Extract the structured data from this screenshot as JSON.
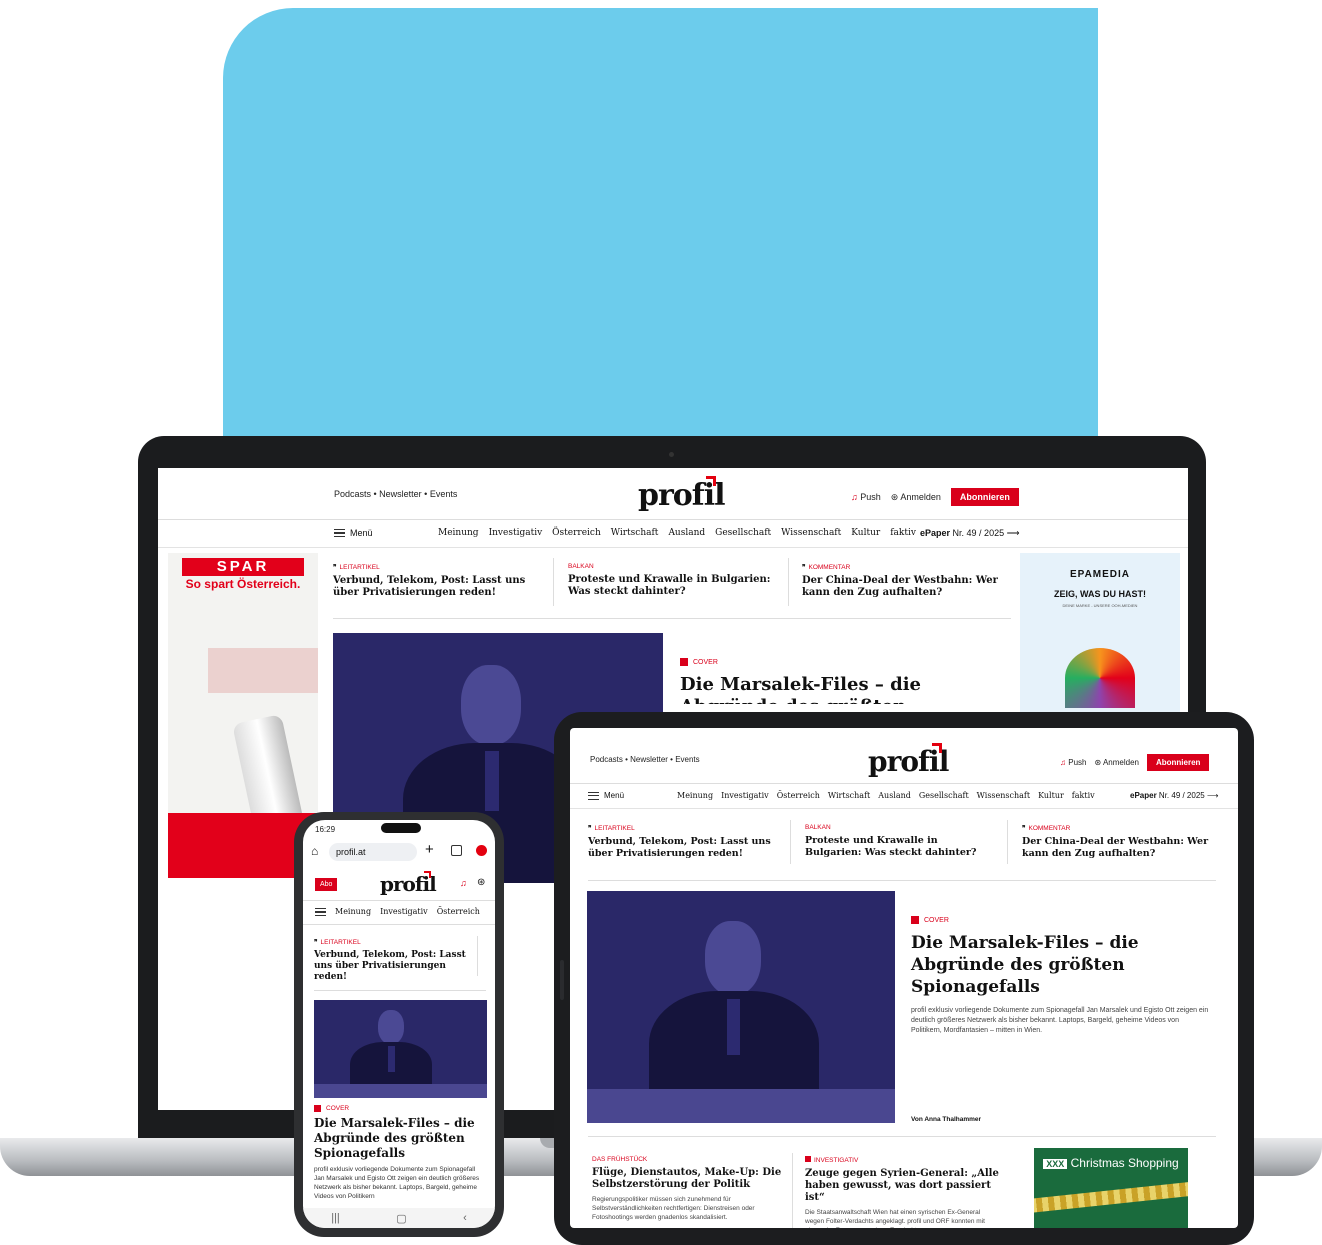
{
  "site": {
    "logo": "profil",
    "top_links": "Podcasts  •  Newsletter  •  Events",
    "push": "Push",
    "login": "Anmelden",
    "subscribe": "Abonnieren",
    "menu": "Menü",
    "nav": [
      "Meinung",
      "Investigativ",
      "Österreich",
      "Wirtschaft",
      "Ausland",
      "Gesellschaft",
      "Wissenschaft",
      "Kultur",
      "faktiv"
    ],
    "epaper_label": "ePaper",
    "epaper_issue": "Nr. 49 / 2025",
    "arrow": "⟶"
  },
  "headlines": [
    {
      "kicker": "Leitartikel",
      "title": "Verbund, Telekom, Post: Lasst uns über Privatisierungen reden!",
      "quote": true
    },
    {
      "kicker": "Balkan",
      "title": "Proteste und Krawalle in Bulgarien: Was steckt dahinter?",
      "quote": false
    },
    {
      "kicker": "Kommentar",
      "title": "Der China-Deal der Westbahn: Wer kann den Zug aufhalten?",
      "quote": true
    }
  ],
  "cover": {
    "kicker": "COVER",
    "title": "Die Marsalek-Files – die Abgründe des größten Spionagefalls",
    "teaser": "profil exklusiv vorliegende Dokumente zum Spionagefall Jan Marsalek und Egisto Ott zeigen ein deutlich größeres Netzwerk als bisher bekannt. Laptops, Bargeld, geheime Videos von Politikern, Mordfantasien – mitten in Wien.",
    "author": "Von Anna Thalhammer"
  },
  "laptop_cover_title_partial": "Die Marsalek-Files – die Abgründe des größten Spionagefalls",
  "secondary": [
    {
      "kicker": "DAS FRÜHSTÜCK",
      "title": "Flüge, Dienstautos, Make-Up: Die Selbstzerstörung der Politik",
      "teaser": "Regierungspolitiker müssen sich zunehmend für Selbstverständlichkeiten rechtfertigen: Dienstreisen oder Fotoshootings werden gnadenlos skandalisiert."
    },
    {
      "kicker": "INVESTIGATIV",
      "title": "Zeuge gegen Syrien-General: „Alle haben gewusst, was dort passiert ist“",
      "teaser": "Die Staatsanwaltschaft Wien hat einen syrischen Ex-General wegen Folter-Verdachts angeklagt. profil und ORF konnten mit einem der Zeugen sprechen. Er erhebt"
    }
  ],
  "ads": {
    "spar_logo": "SPAR",
    "spar_tagline": "So spart Österreich.",
    "epamedia_name": "EPAMEDIA",
    "epamedia_tagline": "ZEIG, WAS DU HAST!",
    "epamedia_sub": "DEINE MARKE - UNSERE OOH-MEDIEN",
    "xxx_brand": "XXX",
    "xxx_title": "Christmas Shopping"
  },
  "phone": {
    "time": "16:29",
    "url": "profil.at",
    "abo": "Abo",
    "nav": [
      "Meinung",
      "Investigativ",
      "Österreich"
    ],
    "headline_kicker": "LEITARTIKEL",
    "headline_title": "Verbund, Telekom, Post: Lasst uns über Privatisierungen reden!",
    "cover_kicker": "COVER",
    "cover_title": "Die Marsalek-Files – die Abgründe des größten Spionagefalls",
    "cover_teaser": "profil exklusiv vorliegende Dokumente zum Spionagefall Jan Marsalek und Egisto Ott zeigen ein deutlich größeres Netzwerk als bisher bekannt. Laptops, Bargeld, geheime Videos von Politikern"
  },
  "colors": {
    "accent": "#d9001b",
    "backdrop": "#6cccec",
    "photo": "#2a2868"
  }
}
